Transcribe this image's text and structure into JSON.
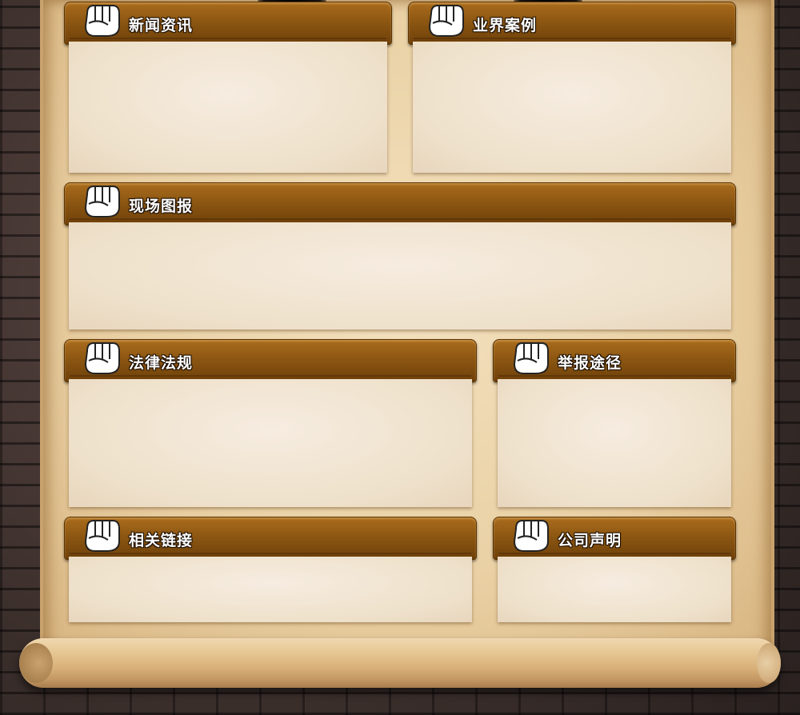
{
  "sections": {
    "news": {
      "title": "新闻资讯"
    },
    "cases": {
      "title": "业界案例"
    },
    "photos": {
      "title": "现场图报"
    },
    "laws": {
      "title": "法律法规"
    },
    "report": {
      "title": "举报途径"
    },
    "links": {
      "title": "相关链接"
    },
    "statement": {
      "title": "公司声明"
    }
  },
  "icons": {
    "section_icon": "fist-icon"
  },
  "colors": {
    "header_brown": "#8d5712",
    "panel_cream": "#efe2cc",
    "paper": "#ead1a5"
  }
}
